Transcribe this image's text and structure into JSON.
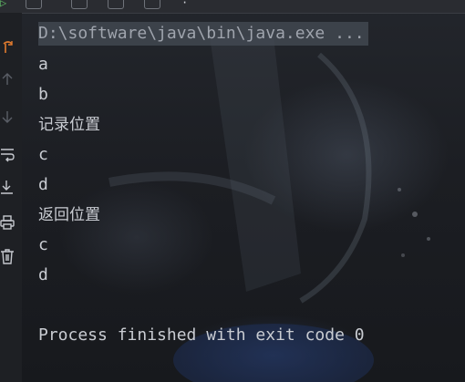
{
  "console": {
    "command": "D:\\software\\java\\bin\\java.exe ...",
    "lines": [
      "a",
      "b",
      "记录位置",
      "c",
      "d",
      "返回位置",
      "c",
      "d"
    ],
    "exit_message": "Process finished with exit code 0"
  },
  "sidebar": {
    "icons": [
      "rerun-icon",
      "scroll-up-icon",
      "scroll-down-icon",
      "soft-wrap-icon",
      "scroll-to-end-icon",
      "print-icon",
      "trash-icon"
    ]
  },
  "colors": {
    "console_text": "#c9ccd2",
    "command_text": "#9fa4ad",
    "command_highlight": "#464c56",
    "rerun_accent": "#e07a2e"
  }
}
